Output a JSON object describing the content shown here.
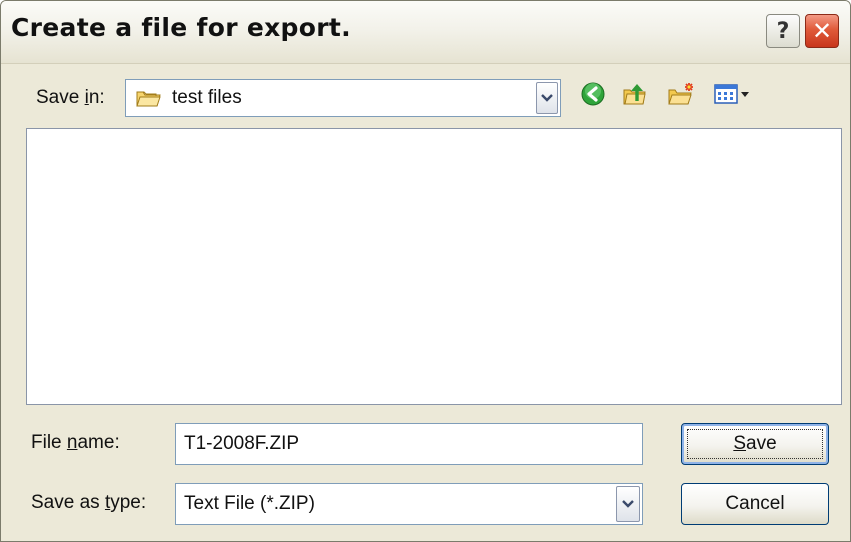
{
  "window": {
    "title": "Create a file for export."
  },
  "title_buttons": {
    "help_glyph": "?",
    "close_glyph": "✕"
  },
  "save_in": {
    "label_pre": "Save ",
    "label_mnemonic": "i",
    "label_post": "n:",
    "value": "test files",
    "folder_icon": "folder-icon"
  },
  "toolbar": {
    "icons": [
      "back-arrow-icon",
      "up-one-level-icon",
      "new-folder-icon",
      "view-menu-icon"
    ]
  },
  "file_name": {
    "label_pre": "File ",
    "label_mnemonic": "n",
    "label_post": "ame:",
    "value": "T1-2008F.ZIP"
  },
  "save_as_type": {
    "label_pre": "Save as ",
    "label_mnemonic": "t",
    "label_post": "ype:",
    "value": "Text File (*.ZIP)"
  },
  "buttons": {
    "save_mnemonic": "S",
    "save_rest": "ave",
    "cancel": "Cancel"
  },
  "colors": {
    "window_bg": "#ece9d8",
    "close_button": "#e05a3a",
    "input_border": "#7f9db9",
    "default_button_border": "#003c74"
  }
}
